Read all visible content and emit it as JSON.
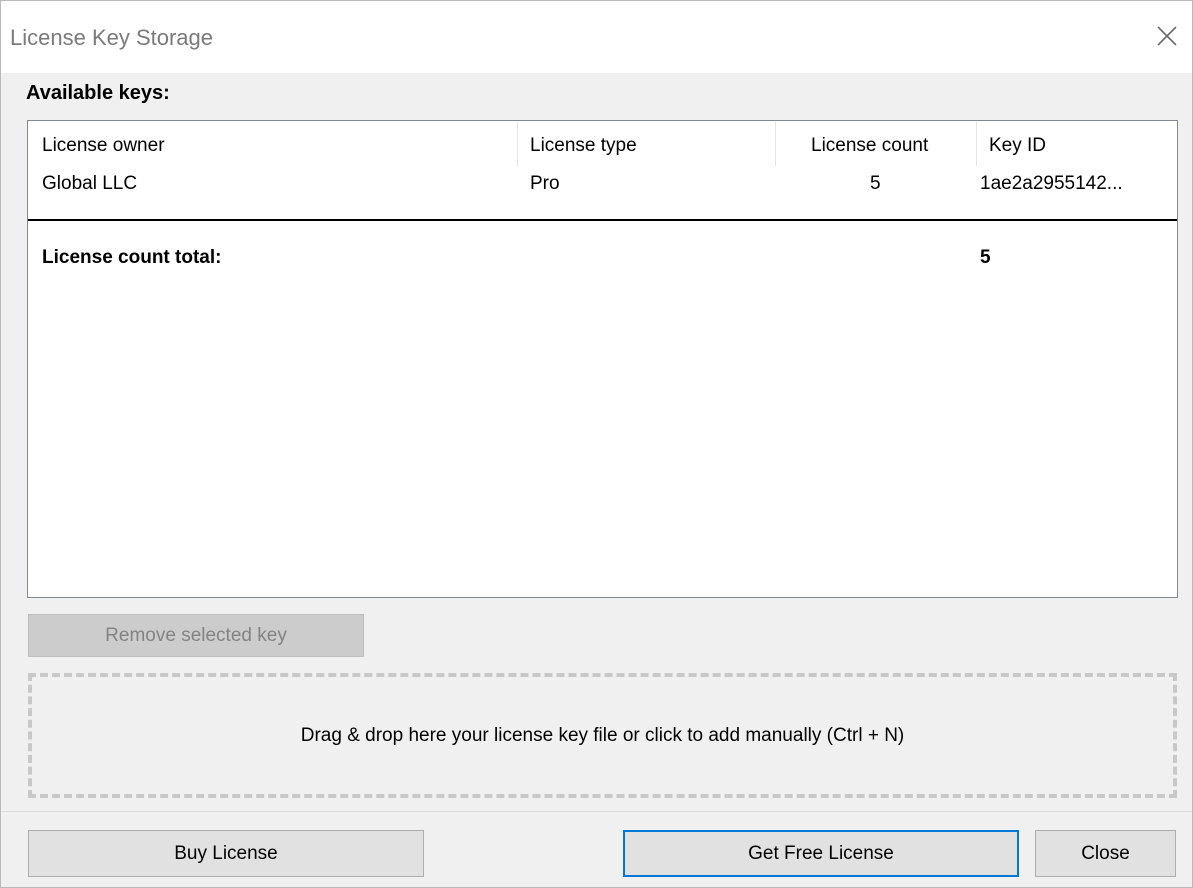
{
  "window": {
    "title": "License Key Storage",
    "close_icon": "close-icon"
  },
  "keys": {
    "section_label": "Available keys:",
    "columns": [
      "License owner",
      "License type",
      "License count",
      "Key ID"
    ],
    "rows": [
      {
        "owner": "Global LLC",
        "type": "Pro",
        "count": "5",
        "key_id": "1ae2a2955142..."
      }
    ],
    "total_label": "License count total:",
    "total_value": "5"
  },
  "actions": {
    "remove_label": "Remove selected key",
    "remove_enabled": false
  },
  "dropzone": {
    "text": "Drag & drop here your license key file or click to add manually (Ctrl + N)"
  },
  "footer": {
    "buy_label": "Buy License",
    "free_label": "Get Free License",
    "close_label": "Close"
  },
  "colors": {
    "focus_border": "#0078d7",
    "disabled_text": "#838383",
    "dashed_border": "#c8c8c8"
  }
}
